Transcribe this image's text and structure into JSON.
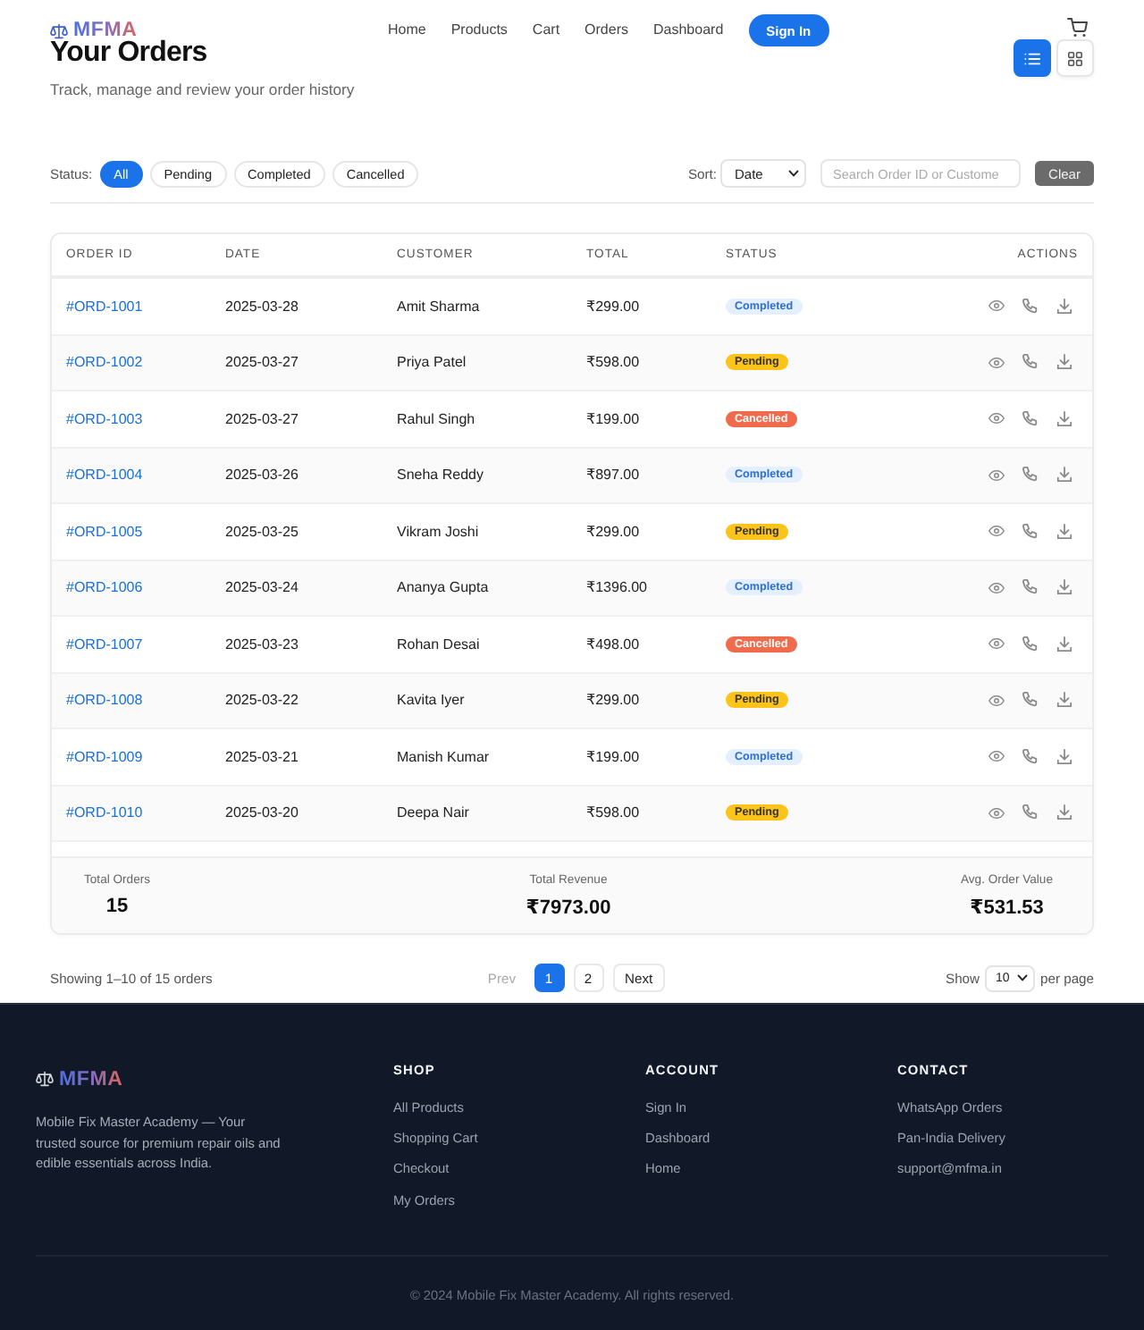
{
  "header": {
    "logo": "MFMA",
    "nav": [
      {
        "label": "Home"
      },
      {
        "label": "Products"
      },
      {
        "label": "Cart"
      },
      {
        "label": "Orders"
      },
      {
        "label": "Dashboard"
      }
    ],
    "sign_in": "Sign In",
    "view_toggle": [
      {
        "kind": "list",
        "selected": true
      },
      {
        "kind": "grid",
        "selected": false
      }
    ]
  },
  "page": {
    "title": "Your Orders",
    "subtitle": "Track, manage and review your order history"
  },
  "filters": {
    "status_label": "Status:",
    "statuses": [
      {
        "label": "All",
        "selected": true
      },
      {
        "label": "Pending",
        "selected": false
      },
      {
        "label": "Completed",
        "selected": false
      },
      {
        "label": "Cancelled",
        "selected": false
      }
    ],
    "sort_label": "Sort:",
    "sort_value": "Date",
    "search": {
      "placeholder": "Search Order ID or Custome"
    },
    "clear_button": "Clear"
  },
  "table": {
    "columns": [
      "ORDER ID",
      "DATE",
      "CUSTOMER",
      "TOTAL",
      "STATUS",
      "ACTIONS"
    ],
    "rows": [
      {
        "order_id": "#ORD-1001",
        "date": "2025-03-28",
        "customer": "Amit Sharma",
        "total": "₹299.00",
        "status": {
          "label": "Completed",
          "kind": "completed"
        }
      },
      {
        "order_id": "#ORD-1002",
        "date": "2025-03-27",
        "customer": "Priya Patel",
        "total": "₹598.00",
        "status": {
          "label": "Pending",
          "kind": "pending"
        }
      },
      {
        "order_id": "#ORD-1003",
        "date": "2025-03-27",
        "customer": "Rahul Singh",
        "total": "₹199.00",
        "status": {
          "label": "Cancelled",
          "kind": "cancelled"
        }
      },
      {
        "order_id": "#ORD-1004",
        "date": "2025-03-26",
        "customer": "Sneha Reddy",
        "total": "₹897.00",
        "status": {
          "label": "Completed",
          "kind": "completed"
        }
      },
      {
        "order_id": "#ORD-1005",
        "date": "2025-03-25",
        "customer": "Vikram Joshi",
        "total": "₹299.00",
        "status": {
          "label": "Pending",
          "kind": "pending"
        }
      },
      {
        "order_id": "#ORD-1006",
        "date": "2025-03-24",
        "customer": "Ananya Gupta",
        "total": "₹1396.00",
        "status": {
          "label": "Completed",
          "kind": "completed"
        }
      },
      {
        "order_id": "#ORD-1007",
        "date": "2025-03-23",
        "customer": "Rohan Desai",
        "total": "₹498.00",
        "status": {
          "label": "Cancelled",
          "kind": "cancelled"
        }
      },
      {
        "order_id": "#ORD-1008",
        "date": "2025-03-22",
        "customer": "Kavita Iyer",
        "total": "₹299.00",
        "status": {
          "label": "Pending",
          "kind": "pending"
        }
      },
      {
        "order_id": "#ORD-1009",
        "date": "2025-03-21",
        "customer": "Manish Kumar",
        "total": "₹199.00",
        "status": {
          "label": "Completed",
          "kind": "completed"
        }
      },
      {
        "order_id": "#ORD-1010",
        "date": "2025-03-20",
        "customer": "Deepa Nair",
        "total": "₹598.00",
        "status": {
          "label": "Pending",
          "kind": "pending"
        }
      }
    ]
  },
  "summary": [
    {
      "label": "Total Orders",
      "value": "15"
    },
    {
      "label": "Total Revenue",
      "value": "₹7973.00"
    },
    {
      "label": "Avg. Order Value",
      "value": "₹531.53"
    }
  ],
  "pagination": {
    "showing": "Showing 1–10 of 15 orders",
    "prev": {
      "label": "Prev",
      "disabled": true
    },
    "pages": [
      {
        "label": "1",
        "selected": true
      },
      {
        "label": "2",
        "selected": false
      }
    ],
    "next": {
      "label": "Next",
      "disabled": false
    },
    "show_label": "Show",
    "per_page": "10",
    "per_page_label": "per page"
  },
  "footer": {
    "logo": "MFMA",
    "description": "Mobile Fix Master Academy — Your trusted source for premium repair oils and edible essentials across India.",
    "columns": [
      {
        "heading": "SHOP",
        "links": [
          "All Products",
          "Shopping Cart",
          "Checkout",
          "My Orders"
        ]
      },
      {
        "heading": "ACCOUNT",
        "links": [
          "Sign In",
          "Dashboard",
          "Home"
        ]
      },
      {
        "heading": "CONTACT",
        "links": [
          "WhatsApp Orders",
          "Pan-India Delivery",
          "support@mfma.in"
        ]
      }
    ],
    "copyright": "© 2024 Mobile Fix Master Academy. All rights reserved."
  }
}
